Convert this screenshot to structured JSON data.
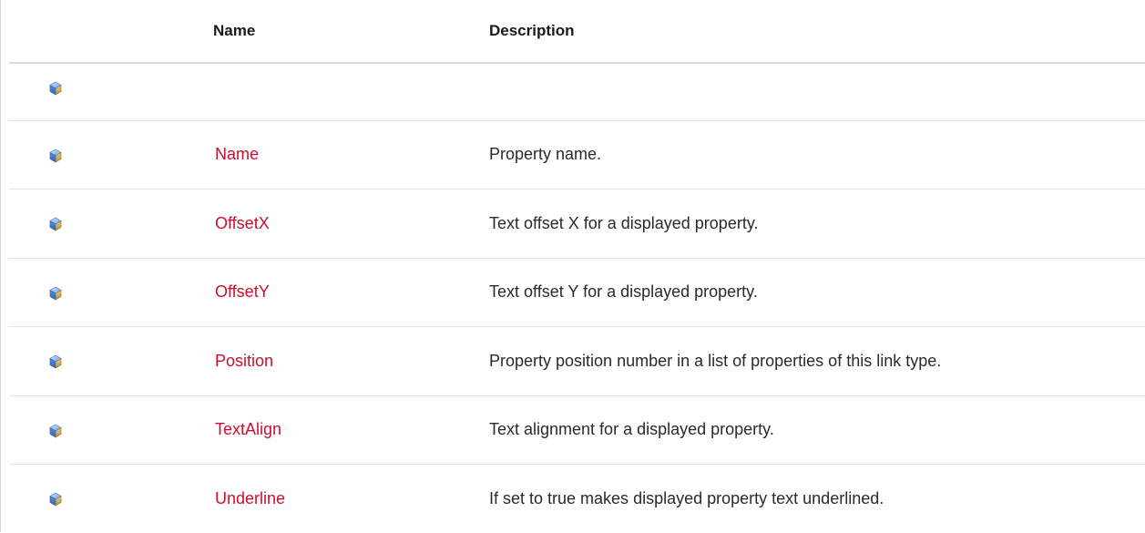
{
  "table": {
    "headers": {
      "icon": "",
      "name": "Name",
      "description": "Description"
    },
    "rows": [
      {
        "icon": "property-icon",
        "name": "",
        "description": ""
      },
      {
        "icon": "property-icon",
        "name": "Name",
        "description": "Property name."
      },
      {
        "icon": "property-icon",
        "name": "OffsetX",
        "description": "Text offset X for a displayed property."
      },
      {
        "icon": "property-icon",
        "name": "OffsetY",
        "description": "Text offset Y for a displayed property."
      },
      {
        "icon": "property-icon",
        "name": "Position",
        "description": "Property position number in a list of properties of this link type."
      },
      {
        "icon": "property-icon",
        "name": "TextAlign",
        "description": "Text alignment for a displayed property."
      },
      {
        "icon": "property-icon",
        "name": "Underline",
        "description": "If set to true makes displayed property text underlined."
      }
    ]
  },
  "colors": {
    "link": "#c8102e",
    "header_text": "#1a1a1a",
    "divider": "#e4e4e4",
    "icon_blue": "#3a78d8"
  }
}
